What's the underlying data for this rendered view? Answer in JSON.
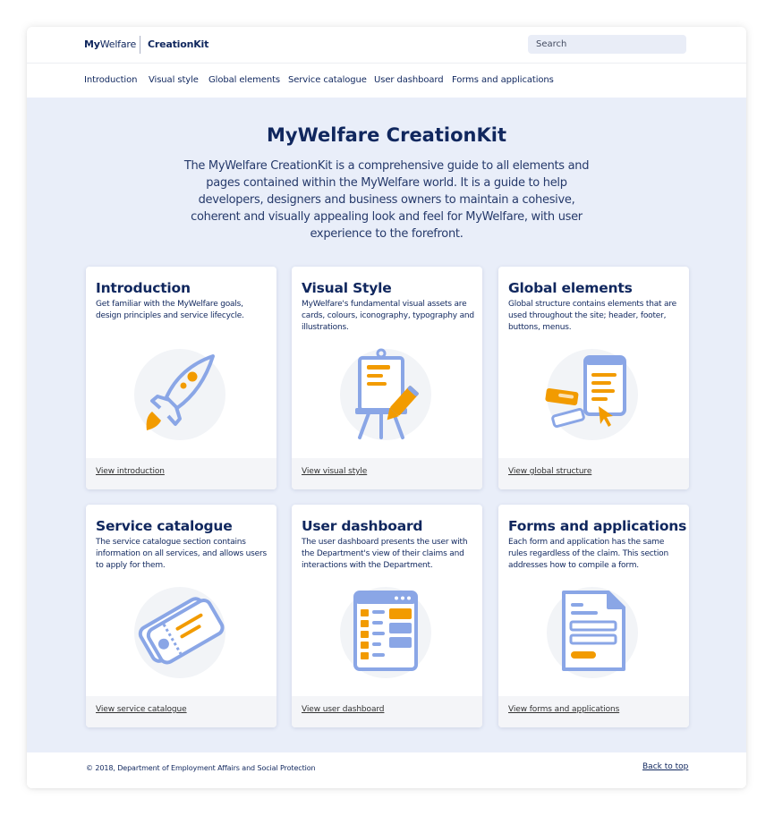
{
  "header": {
    "brand_my": "My",
    "brand_welfare": "Welfare",
    "brand_kit": "CreationKit",
    "search_placeholder": "Search"
  },
  "nav": {
    "items": [
      {
        "label": "Introduction"
      },
      {
        "label": "Visual style"
      },
      {
        "label": "Global elements"
      },
      {
        "label": "Service catalogue"
      },
      {
        "label": "User dashboard"
      },
      {
        "label": "Forms and applications"
      }
    ]
  },
  "hero": {
    "title": "MyWelfare CreationKit",
    "description": "The MyWelfare CreationKit is a comprehensive guide to all elements and pages contained within the MyWelfare world. It is a guide to help developers, designers and business owners to maintain a cohesive, coherent and visually appealing look and feel for MyWelfare, with user experience to the forefront."
  },
  "cards": [
    {
      "title": "Introduction",
      "description": "Get familiar with the MyWelfare goals, design principles and service lifecycle.",
      "link": "View introduction",
      "icon": "rocket-icon"
    },
    {
      "title": "Visual Style",
      "description": "MyWelfare's fundamental visual assets are cards, colours, iconography, typography and illustrations.",
      "link": "View visual style",
      "icon": "easel-pencil-icon"
    },
    {
      "title": "Global elements",
      "description": "Global structure contains elements that are used throughout the site; header, footer, buttons, menus.",
      "link": "View global structure",
      "icon": "phone-ui-icon"
    },
    {
      "title": "Service catalogue",
      "description": "The service catalogue section contains information on all services, and allows users to apply for them.",
      "link": "View service catalogue",
      "icon": "ticket-icon"
    },
    {
      "title": "User dashboard",
      "description": "The user dashboard presents the user with the Department's view of their claims and interactions with the Department.",
      "link": "View user dashboard",
      "icon": "dashboard-window-icon"
    },
    {
      "title": "Forms and applications",
      "description": "Each form and application has the same rules regardless of the claim. This section addresses how to compile a form.",
      "link": "View forms and applications",
      "icon": "form-document-icon"
    }
  ],
  "footer": {
    "copyright": "© 2018, Department of Employment Affairs and Social Protection",
    "back_to_top": "Back to top"
  },
  "colors": {
    "navy": "#10275e",
    "hero_bg": "#e9eef9",
    "accent_orange": "#f29b00",
    "icon_blue": "#8aa6e6",
    "icon_circle": "#f2f4f7"
  }
}
